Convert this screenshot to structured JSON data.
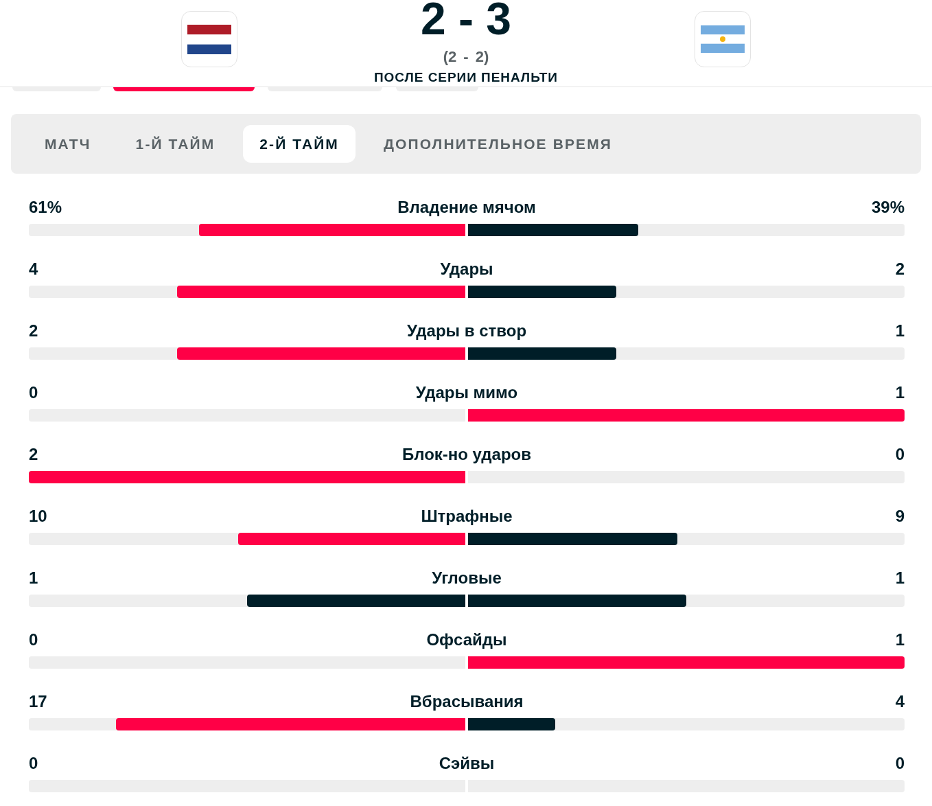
{
  "header": {
    "score": "2 - 3",
    "aggregate": "(2 - 2)",
    "note": "ПОСЛЕ СЕРИИ ПЕНАЛЬТИ"
  },
  "hidden_tabs": [
    {
      "selected": false
    },
    {
      "selected": true
    },
    {
      "selected": false
    },
    {
      "selected": false
    }
  ],
  "period_tabs": [
    {
      "label": "МАТЧ",
      "selected": false
    },
    {
      "label": "1-Й ТАЙМ",
      "selected": false
    },
    {
      "label": "2-Й ТАЙМ",
      "selected": true
    },
    {
      "label": "ДОПОЛНИТЕЛЬНОЕ ВРЕМЯ",
      "selected": false
    }
  ],
  "stats": [
    {
      "name": "Владение мячом",
      "home": {
        "value": "61%",
        "level": 0.61,
        "color": "#ff0046"
      },
      "away": {
        "value": "39%",
        "level": 0.39,
        "color": "#001e28"
      }
    },
    {
      "name": "Удары",
      "home": {
        "value": "4",
        "level": 0.66,
        "color": "#ff0046"
      },
      "away": {
        "value": "2",
        "level": 0.34,
        "color": "#001e28"
      }
    },
    {
      "name": "Удары в створ",
      "home": {
        "value": "2",
        "level": 0.66,
        "color": "#ff0046"
      },
      "away": {
        "value": "1",
        "level": 0.34,
        "color": "#001e28"
      }
    },
    {
      "name": "Удары мимо",
      "home": {
        "value": "0",
        "level": 0
      },
      "away": {
        "value": "1",
        "level": 1,
        "color": "#ff0046"
      }
    },
    {
      "name": "Блок-но ударов",
      "home": {
        "value": "2",
        "level": 1,
        "color": "#ff0046"
      },
      "away": {
        "value": "0",
        "level": 0
      }
    },
    {
      "name": "Штрафные",
      "home": {
        "value": "10",
        "level": 0.52,
        "color": "#ff0046"
      },
      "away": {
        "value": "9",
        "level": 0.48,
        "color": "#001e28"
      }
    },
    {
      "name": "Угловые",
      "home": {
        "value": "1",
        "level": 0.5,
        "color": "#001e28"
      },
      "away": {
        "value": "1",
        "level": 0.5,
        "color": "#001e28"
      }
    },
    {
      "name": "Офсайды",
      "home": {
        "value": "0",
        "level": 0
      },
      "away": {
        "value": "1",
        "level": 1,
        "color": "#ff0046"
      }
    },
    {
      "name": "Вбрасывания",
      "home": {
        "value": "17",
        "level": 0.8,
        "color": "#ff0046"
      },
      "away": {
        "value": "4",
        "level": 0.2,
        "color": "#001e28"
      }
    },
    {
      "name": "Сэйвы",
      "home": {
        "value": "0",
        "level": 0
      },
      "away": {
        "value": "0",
        "level": 0
      }
    }
  ]
}
